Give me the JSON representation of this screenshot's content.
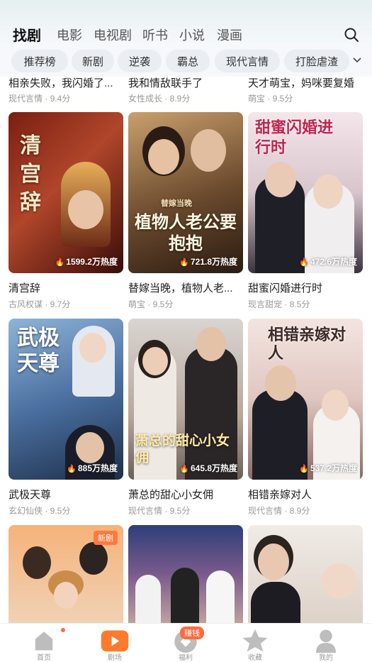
{
  "top_tabs": [
    "找剧",
    "电影",
    "电视剧",
    "听书",
    "小说",
    "漫画"
  ],
  "chips": [
    "推荐榜",
    "新剧",
    "逆袭",
    "霸总",
    "现代言情",
    "打脸虐渣"
  ],
  "prev_row": [
    {
      "title": "相亲失败，我闪婚了...",
      "meta": "现代言情 · 9.4分"
    },
    {
      "title": "我和情敌联手了",
      "meta": "女性成长 · 8.9分"
    },
    {
      "title": "天才萌宝，妈咪要复婚",
      "meta": "萌宝 · 9.5分"
    }
  ],
  "cards": [
    {
      "title": "清宫辞",
      "meta": "古风权谋 · 9.7分",
      "heat": "1599.2万热度",
      "poster_text": "清宫辞"
    },
    {
      "title": "替嫁当晚，植物人老...",
      "meta": "萌宝 · 9.5分",
      "heat": "721.8万热度",
      "poster_text": "植物人老公要抱抱",
      "poster_sub": "替嫁当晚"
    },
    {
      "title": "甜蜜闪婚进行时",
      "meta": "现言甜宠 · 8.5分",
      "heat": "472.6万热度",
      "poster_text": "甜蜜闪婚进行时"
    },
    {
      "title": "武极天尊",
      "meta": "玄幻仙侠 · 9.5分",
      "heat": "885万热度",
      "poster_text": "武极天尊"
    },
    {
      "title": "萧总的甜心小女佣",
      "meta": "现代言情 · 9.5分",
      "heat": "645.8万热度",
      "poster_text": "萧总的甜心小女佣"
    },
    {
      "title": "相错亲嫁对人",
      "meta": "现代言情 · 8.9分",
      "heat": "537.2万热度",
      "poster_text": "相错亲嫁对人"
    }
  ],
  "new_badge": "新剧",
  "nav": [
    "首页",
    "剧场",
    "福利",
    "收藏",
    "我的"
  ],
  "earn_badge": "赚钱",
  "colors": {
    "accent": "#ff6a3d",
    "play": "#ff7a2d"
  }
}
